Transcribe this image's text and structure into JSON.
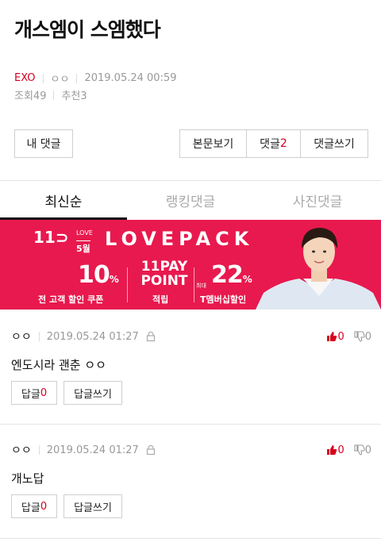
{
  "post": {
    "title": "개스엠이 스엠했다",
    "category": "EXO",
    "author": "ㅇㅇ",
    "datetime": "2019.05.24 00:59",
    "views": "조회49",
    "recommends": "추천3"
  },
  "actions": {
    "my_comments": "내 댓글",
    "view_post": "본문보기",
    "comments_label": "댓글",
    "comments_count": "2",
    "write_comment": "댓글쓰기"
  },
  "tabs": [
    {
      "label": "최신순",
      "active": true
    },
    {
      "label": "랭킹댓글",
      "active": false
    },
    {
      "label": "사진댓글",
      "active": false
    }
  ],
  "banner": {
    "logo": "11⊃",
    "love": "LOVE",
    "month": "5월",
    "headline": "LOVEPACK",
    "offer1_value": "10",
    "offer1_unit": "%",
    "offer1_caption": "전 고객 할인 쿠폰",
    "offer2_value": "11PAY POINT",
    "offer2_caption": "적립",
    "offer3_prefix": "최대",
    "offer3_value": "22",
    "offer3_unit": "%",
    "offer3_caption": "T멤버십할인"
  },
  "comments": [
    {
      "author": "ㅇㅇ",
      "datetime": "2019.05.24 01:27",
      "text": "엔도시라 괜춘 ㅇㅇ",
      "likes": "0",
      "dislikes": "0",
      "reply_label": "답글",
      "reply_count": "0",
      "write_reply": "답글쓰기"
    },
    {
      "author": "ㅇㅇ",
      "datetime": "2019.05.24 01:27",
      "text": "개노답",
      "likes": "0",
      "dislikes": "0",
      "reply_label": "답글",
      "reply_count": "0",
      "write_reply": "답글쓰기"
    }
  ],
  "colors": {
    "accent": "#d7001f",
    "banner_bg": "#e8194e"
  }
}
